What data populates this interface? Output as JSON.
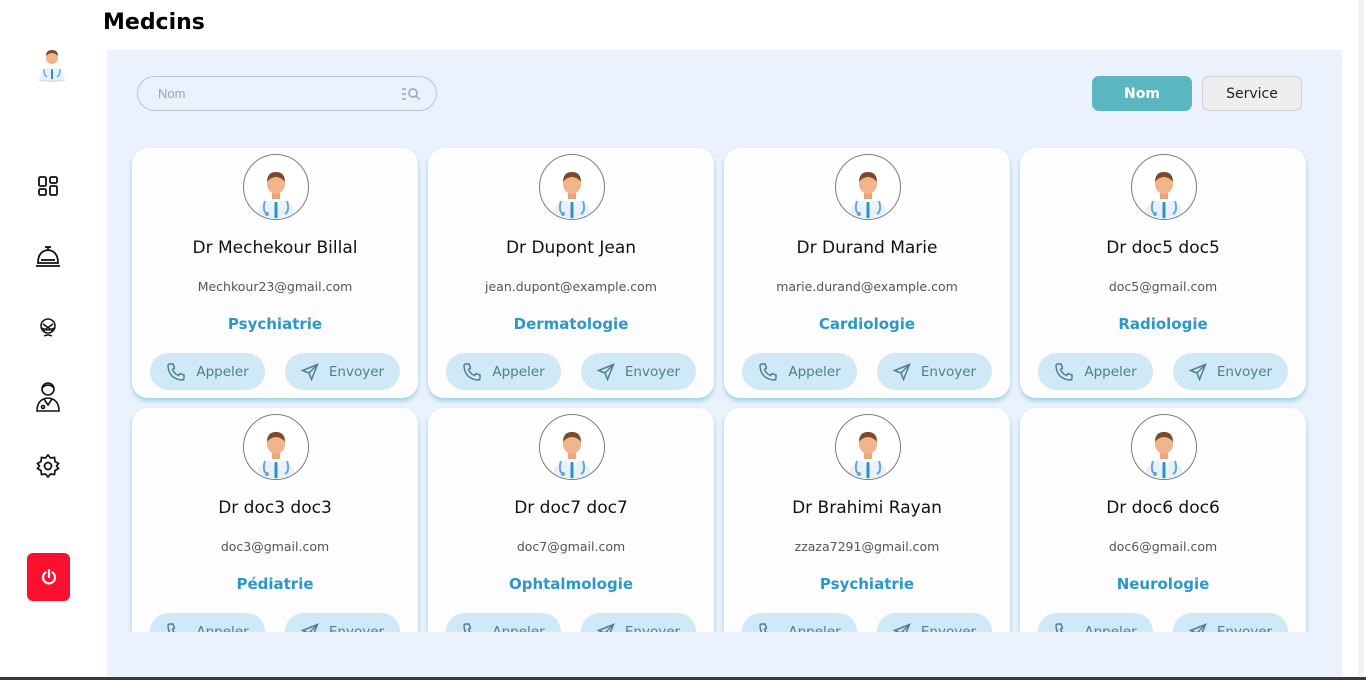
{
  "app": {
    "title": "Medcins"
  },
  "sidebar": {
    "logo_icon": "doctor-avatar-icon",
    "items": [
      {
        "icon": "dashboard-grid-icon"
      },
      {
        "icon": "service-bell-icon"
      },
      {
        "icon": "patient-mask-icon"
      },
      {
        "icon": "doctor-icon"
      },
      {
        "icon": "settings-gear-icon"
      }
    ],
    "logout_icon": "power-icon",
    "logout_color": "#ff0f2e"
  },
  "search": {
    "placeholder": "Nom",
    "value": ""
  },
  "filters": {
    "nom_label": "Nom",
    "service_label": "Service",
    "active": "Nom",
    "active_color": "#5ab7c2"
  },
  "actions": {
    "call_label": "Appeler",
    "send_label": "Envoyer"
  },
  "accent_color": "#2c97c9",
  "doctors": [
    {
      "name": "Dr Mechekour Billal",
      "email": "Mechkour23@gmail.com",
      "service": "Psychiatrie"
    },
    {
      "name": "Dr Dupont Jean",
      "email": "jean.dupont@example.com",
      "service": "Dermatologie"
    },
    {
      "name": "Dr Durand Marie",
      "email": "marie.durand@example.com",
      "service": "Cardiologie"
    },
    {
      "name": "Dr doc5 doc5",
      "email": "doc5@gmail.com",
      "service": "Radiologie"
    },
    {
      "name": "Dr doc3 doc3",
      "email": "doc3@gmail.com",
      "service": "Pédiatrie"
    },
    {
      "name": "Dr doc7 doc7",
      "email": "doc7@gmail.com",
      "service": "Ophtalmologie"
    },
    {
      "name": "Dr Brahimi Rayan",
      "email": "zzaza7291@gmail.com",
      "service": "Psychiatrie"
    },
    {
      "name": "Dr doc6 doc6",
      "email": "doc6@gmail.com",
      "service": "Neurologie"
    }
  ]
}
